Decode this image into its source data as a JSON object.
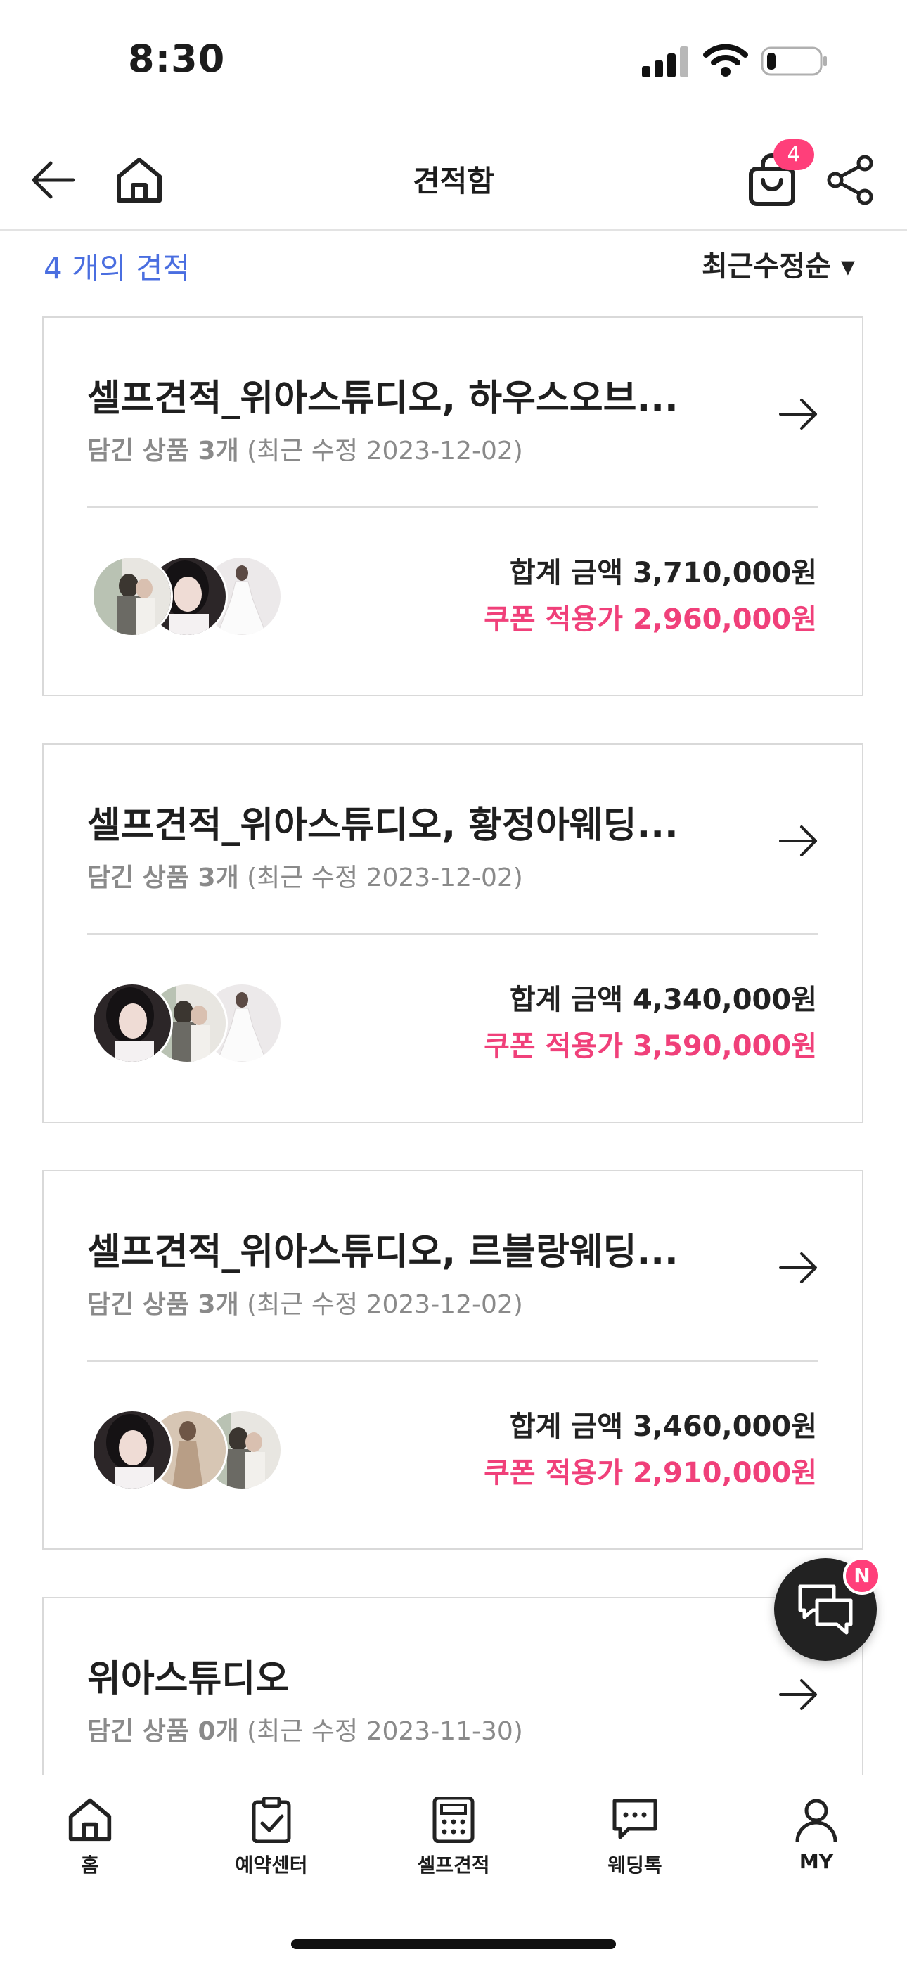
{
  "status_bar": {
    "time": "8:30"
  },
  "header": {
    "title": "견적함",
    "cart_count": "4"
  },
  "summary": {
    "count_label": "4 개의 견적",
    "sort_label": "최근수정순 ▾"
  },
  "cards": [
    {
      "title": "셀프견적_위아스튜디오, 하우스오브...",
      "items_label": "담긴 상품 3개",
      "updated": " (최근 수정 2023-12-02)",
      "total": "합계 금액 3,710,000원",
      "coupon": "쿠폰 적용가 2,960,000원",
      "thumbs": [
        "couple-photo",
        "bride-portrait",
        "wedding-dress"
      ]
    },
    {
      "title": "셀프견적_위아스튜디오, 황정아웨딩...",
      "items_label": "담긴 상품 3개",
      "updated": " (최근 수정 2023-12-02)",
      "total": "합계 금액 4,340,000원",
      "coupon": "쿠폰 적용가 3,590,000원",
      "thumbs": [
        "bride-portrait",
        "couple-photo",
        "wedding-dress"
      ]
    },
    {
      "title": "셀프견적_위아스튜디오, 르블랑웨딩...",
      "items_label": "담긴 상품 3개",
      "updated": " (최근 수정 2023-12-02)",
      "total": "합계 금액 3,460,000원",
      "coupon": "쿠폰 적용가 2,910,000원",
      "thumbs": [
        "bride-portrait",
        "beige-gown",
        "couple-photo"
      ]
    },
    {
      "title": "위아스튜디오",
      "items_label": "담긴 상품 0개",
      "updated": " (최근 수정 2023-11-30)",
      "total": "",
      "coupon": "",
      "thumbs": []
    }
  ],
  "chat": {
    "badge": "N"
  },
  "nav": [
    {
      "label": "홈",
      "icon": "home-icon"
    },
    {
      "label": "예약센터",
      "icon": "clipboard-check-icon"
    },
    {
      "label": "셀프견적",
      "icon": "calculator-icon"
    },
    {
      "label": "웨딩톡",
      "icon": "chat-bubble-icon"
    },
    {
      "label": "MY",
      "icon": "user-icon"
    }
  ],
  "colors": {
    "accent_pink": "#f0407a",
    "link_blue": "#4a6ee0",
    "badge_pink": "#ff3f7a"
  }
}
